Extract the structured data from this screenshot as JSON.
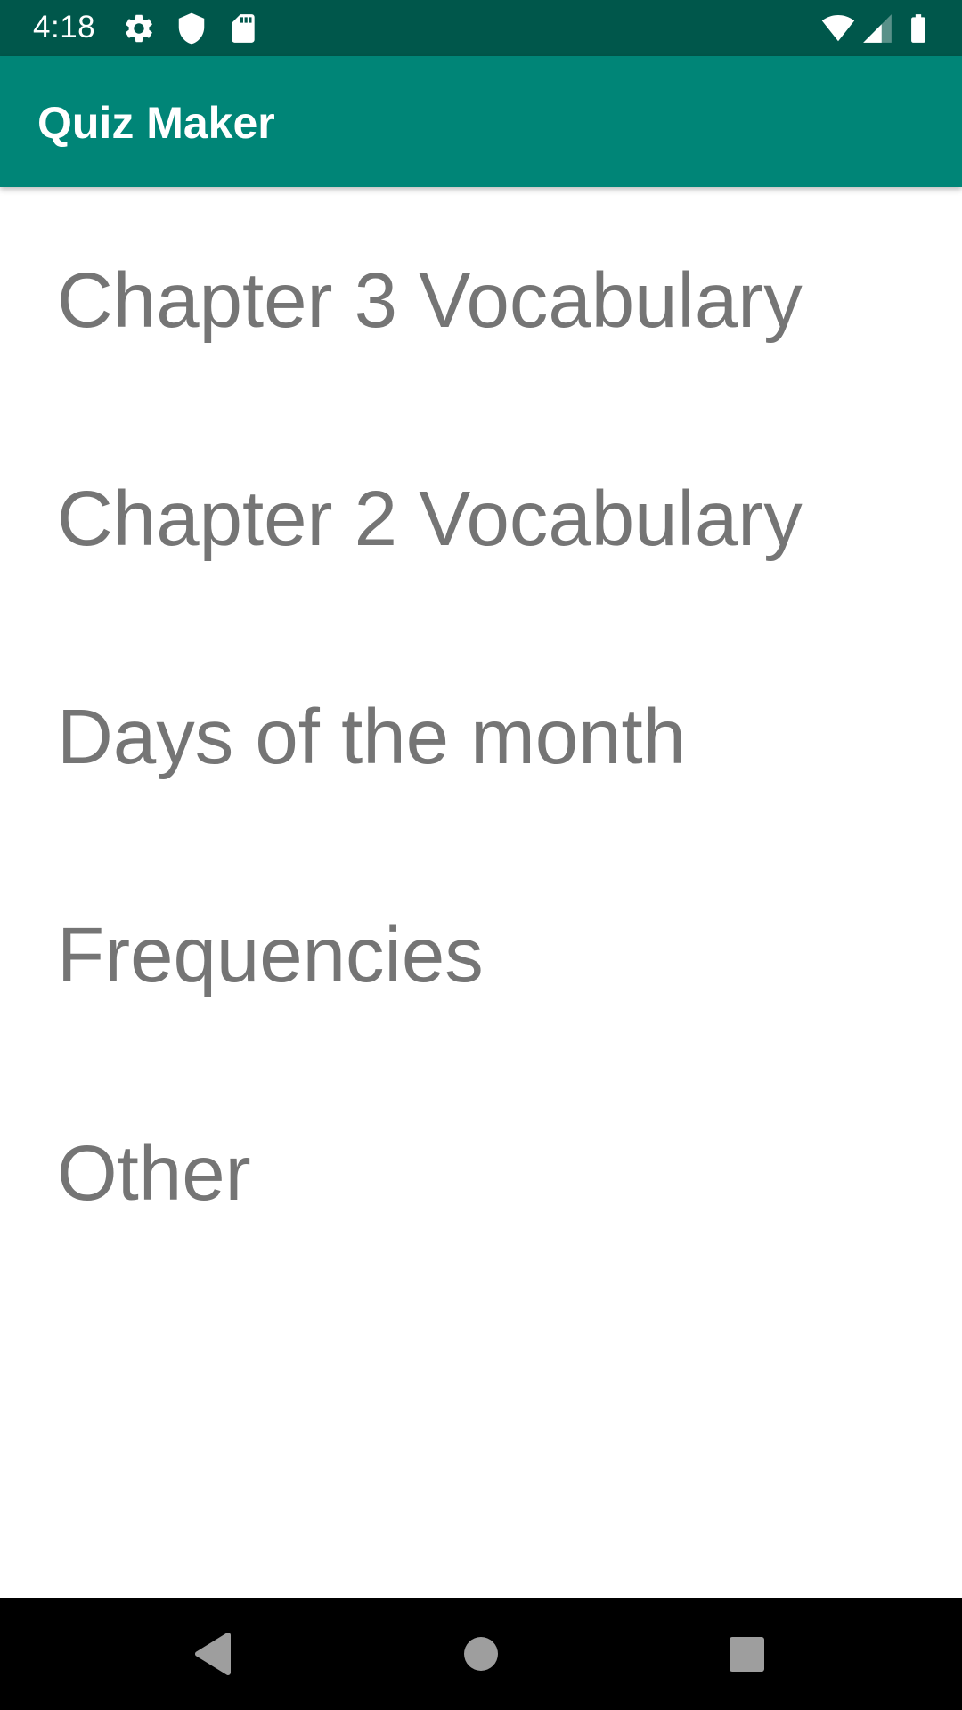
{
  "status_bar": {
    "time": "4:18",
    "left_icons": [
      "gear-icon",
      "shield-icon",
      "sd-card-icon"
    ],
    "right_icons": [
      "wifi-icon",
      "cell-signal-icon",
      "battery-icon"
    ],
    "background_color": "#00574B"
  },
  "app_bar": {
    "title": "Quiz Maker",
    "background_color": "#008577"
  },
  "quiz_list": {
    "items": [
      {
        "label": "Chapter 3 Vocabulary"
      },
      {
        "label": "Chapter 2 Vocabulary"
      },
      {
        "label": "Days of the month"
      },
      {
        "label": "Frequencies"
      },
      {
        "label": "Other"
      }
    ],
    "text_color": "#757575"
  },
  "nav_bar": {
    "buttons": [
      "back-icon",
      "home-icon",
      "recents-icon"
    ],
    "background_color": "#000000",
    "button_color": "#9E9E9E"
  }
}
